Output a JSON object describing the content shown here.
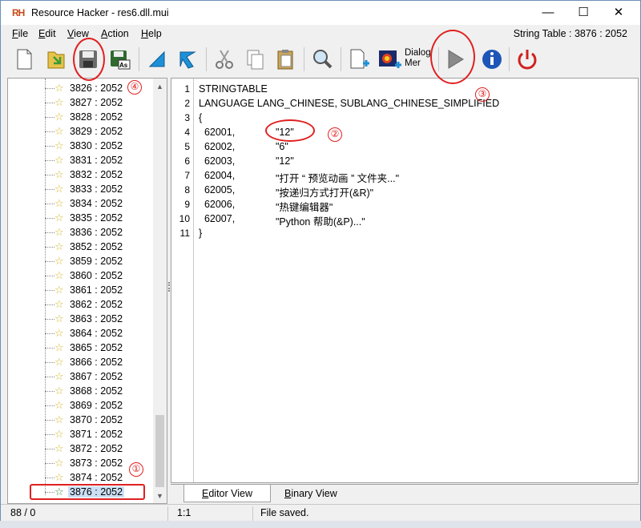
{
  "window": {
    "logo": "RH",
    "title": "Resource Hacker - res6.dll.mui",
    "minimize": "—",
    "maximize": "☐",
    "close": "✕"
  },
  "menu": [
    {
      "key": "F",
      "rest": "ile"
    },
    {
      "key": "E",
      "rest": "dit"
    },
    {
      "key": "V",
      "rest": "iew"
    },
    {
      "key": "A",
      "rest": "ction"
    },
    {
      "key": "H",
      "rest": "elp"
    }
  ],
  "resource_label": "String Table : 3876 : 2052",
  "toolbar": {
    "dialog_menu_label_1": "Dialog",
    "dialog_menu_label_2": "Mer"
  },
  "tree_items": [
    "3826 : 2052",
    "3827 : 2052",
    "3828 : 2052",
    "3829 : 2052",
    "3830 : 2052",
    "3831 : 2052",
    "3832 : 2052",
    "3833 : 2052",
    "3834 : 2052",
    "3835 : 2052",
    "3836 : 2052",
    "3852 : 2052",
    "3859 : 2052",
    "3860 : 2052",
    "3861 : 2052",
    "3862 : 2052",
    "3863 : 2052",
    "3864 : 2052",
    "3865 : 2052",
    "3866 : 2052",
    "3867 : 2052",
    "3868 : 2052",
    "3869 : 2052",
    "3870 : 2052",
    "3871 : 2052",
    "3872 : 2052",
    "3873 : 2052",
    "3874 : 2052",
    "3876 : 2052"
  ],
  "editor": {
    "lines": [
      {
        "num": "1",
        "text": "STRINGTABLE",
        "value": ""
      },
      {
        "num": "2",
        "text": "LANGUAGE LANG_CHINESE, SUBLANG_CHINESE_SIMPLIFIED",
        "value": ""
      },
      {
        "num": "3",
        "text": "{",
        "value": ""
      },
      {
        "num": "4",
        "text": "  62001,",
        "value": "\"12\""
      },
      {
        "num": "5",
        "text": "  62002,",
        "value": "\"6\""
      },
      {
        "num": "6",
        "text": "  62003,",
        "value": "\"12\""
      },
      {
        "num": "7",
        "text": "  62004,",
        "value": "\"打开 “ 预览动画 ” 文件夹...\""
      },
      {
        "num": "8",
        "text": "  62005,",
        "value": "\"按递归方式打开(&R)\""
      },
      {
        "num": "9",
        "text": "  62006,",
        "value": "\"热键编辑器\""
      },
      {
        "num": "10",
        "text": "  62007,",
        "value": "\"Python 帮助(&P)...\""
      },
      {
        "num": "11",
        "text": "}",
        "value": ""
      }
    ]
  },
  "tabs": [
    {
      "key": "E",
      "rest": "ditor View"
    },
    {
      "key": "B",
      "rest": "inary View"
    }
  ],
  "status": {
    "count": "88 / 0",
    "position": "1:1",
    "message": "File saved."
  },
  "annotations": {
    "n1": "①",
    "n2": "②",
    "n3": "③",
    "n4": "④"
  },
  "colors": {
    "annotation": "#e02020",
    "selected_row": "#cce0f5"
  }
}
